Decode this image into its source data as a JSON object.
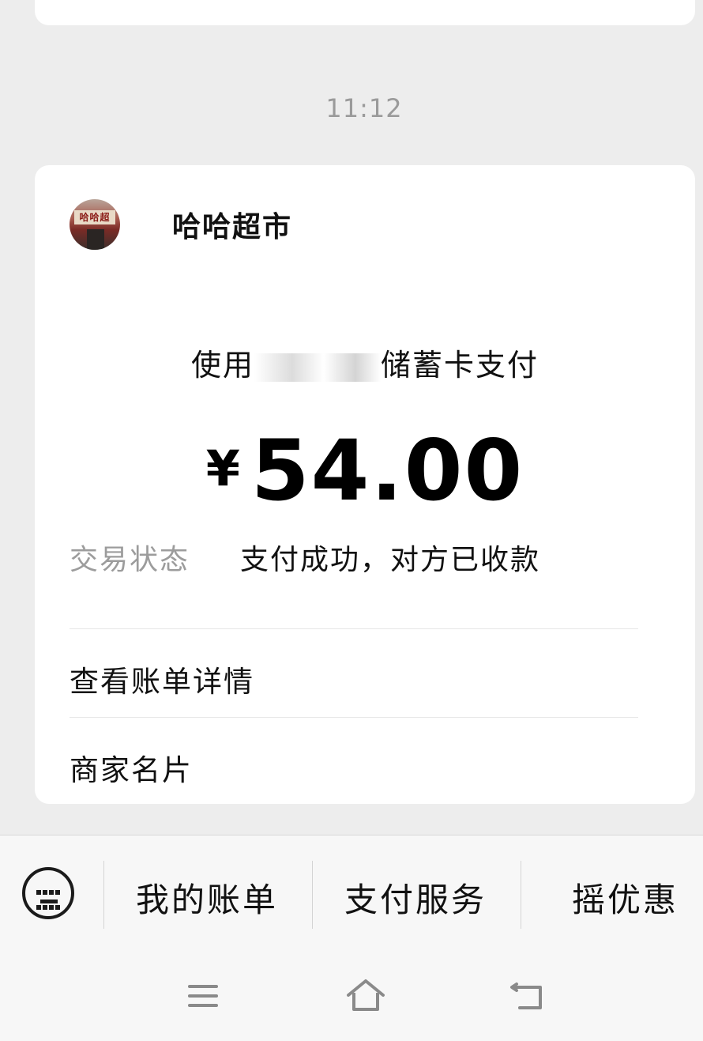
{
  "chat": {
    "timestamp": "11:12"
  },
  "card": {
    "merchant_name": "哈哈超市",
    "avatar_sign": "哈哈超",
    "payment_prefix": "使用",
    "payment_suffix": "储蓄卡支付",
    "amount_symbol": "¥",
    "amount": "54.00",
    "status_label": "交易状态",
    "status_value": "支付成功，对方已收款",
    "links": [
      "查看账单详情",
      "商家名片"
    ]
  },
  "bottom_menu": {
    "items": [
      "我的账单",
      "支付服务",
      "摇优惠"
    ]
  },
  "icons": {
    "keyboard": "keyboard-icon",
    "nav_menu": "menu-icon",
    "nav_home": "home-icon",
    "nav_back": "back-icon"
  }
}
